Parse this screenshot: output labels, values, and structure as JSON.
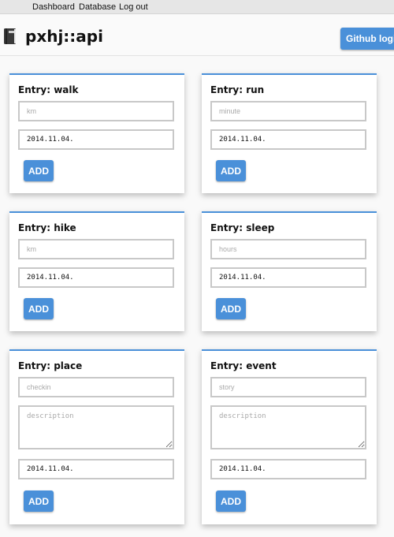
{
  "nav": {
    "dashboard": "Dashboard",
    "database": "Database",
    "logout": "Log out"
  },
  "header": {
    "icon": "book-icon",
    "title": "pxhj::api",
    "login_button": "Github login"
  },
  "add_label": "ADD",
  "entries": [
    {
      "title": "Entry: walk",
      "input_placeholder": "km",
      "date": "2014.11.04."
    },
    {
      "title": "Entry: run",
      "input_placeholder": "minute",
      "date": "2014.11.04."
    },
    {
      "title": "Entry: hike",
      "input_placeholder": "km",
      "date": "2014.11.04."
    },
    {
      "title": "Entry: sleep",
      "input_placeholder": "hours",
      "date": "2014.11.04."
    },
    {
      "title": "Entry: place",
      "input_placeholder": "checkin",
      "textarea_placeholder": "description",
      "date": "2014.11.04."
    },
    {
      "title": "Entry: event",
      "input_placeholder": "story",
      "textarea_placeholder": "description",
      "date": "2014.11.04."
    }
  ],
  "colors": {
    "accent": "#4a90d9",
    "nav_bg": "#e6e6e6",
    "field_border": "#c8c8c8"
  }
}
